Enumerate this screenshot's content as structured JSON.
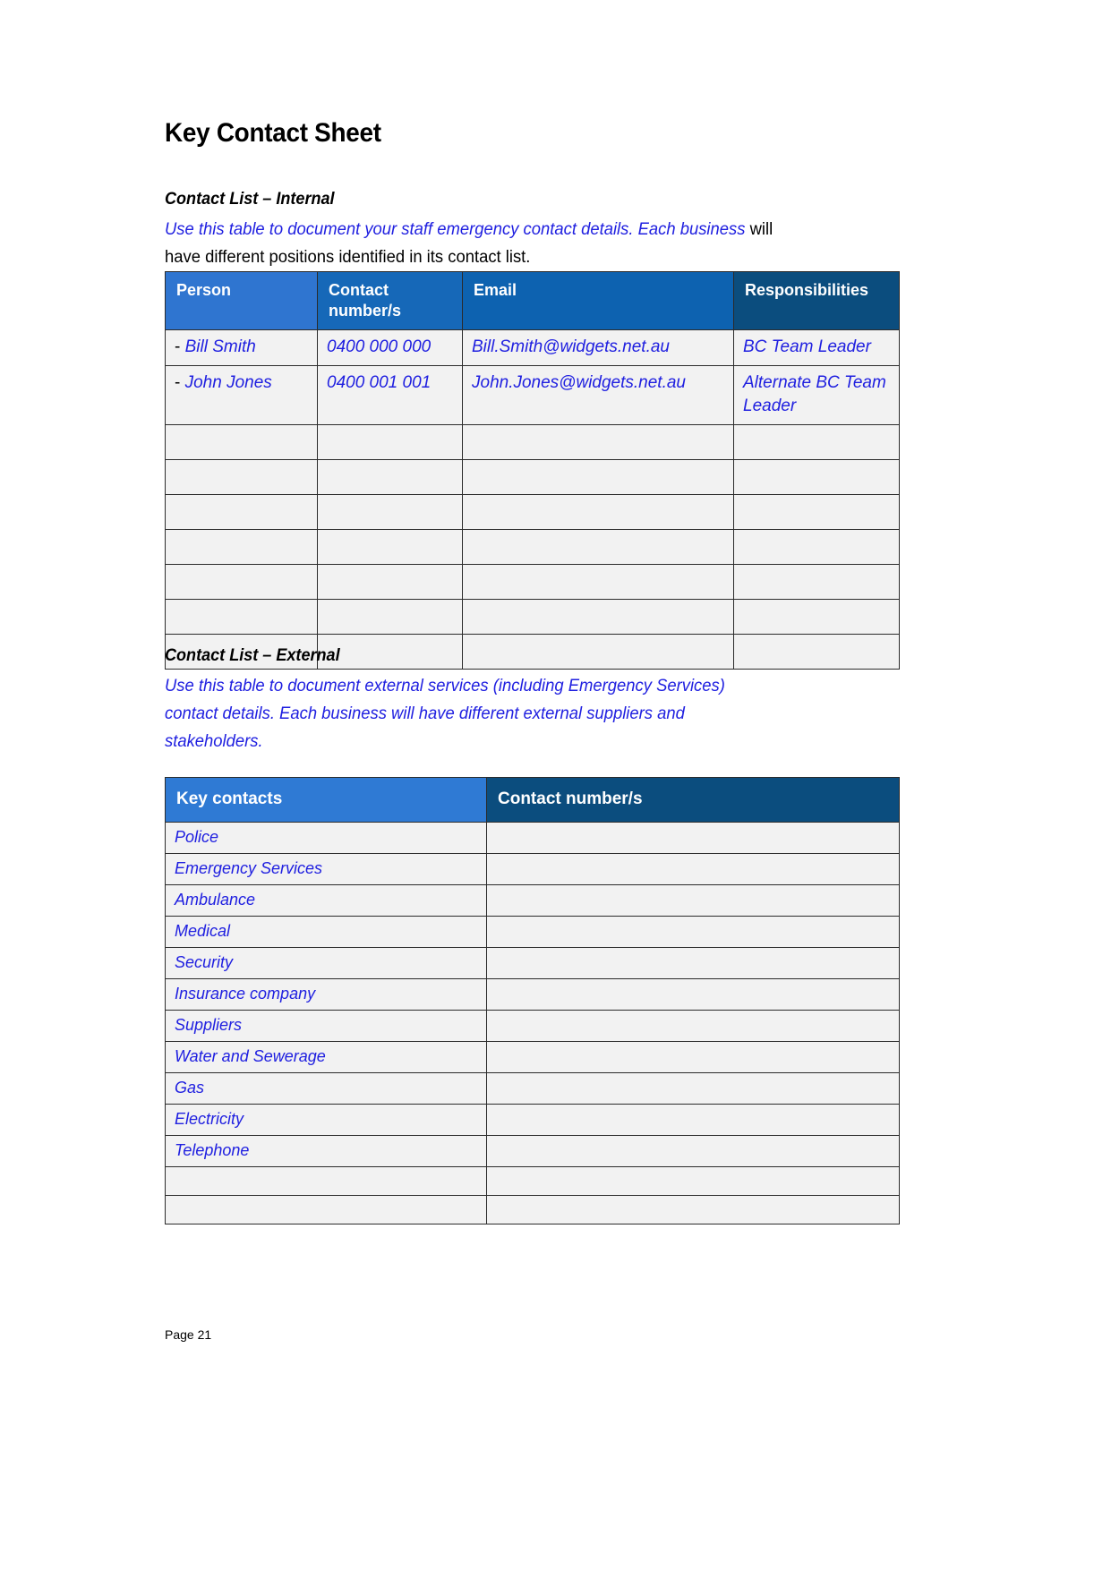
{
  "document": {
    "title": "Key Contact Sheet",
    "footer_page_label": "Page 21"
  },
  "colors": {
    "link_blue": "#2020e0",
    "header_blue_light": "#2f75d0",
    "header_blue_dark": "#0b4d7e",
    "cell_fill": "#f2f2f2",
    "border": "#2b2b2b"
  },
  "internal": {
    "heading": "Contact List – Internal",
    "intro_part1": "Use this table to document your staff emergency contact details. Each business",
    "intro_part2": " will have different positions identified in its contact list.",
    "columns": [
      "Person",
      "Contact number/s",
      "Email",
      "Responsibilities"
    ],
    "rows": [
      {
        "dash": "- ",
        "person": "Bill Smith",
        "contact": "0400 000 000",
        "email": "Bill.Smith@widgets.net.au",
        "responsibilities": "BC Team Leader"
      },
      {
        "dash": "- ",
        "person": "John Jones",
        "contact": "0400 001 001",
        "email": "John.Jones@widgets.net.au",
        "responsibilities": "Alternate BC Team Leader"
      }
    ],
    "empty_row_count": 7
  },
  "external": {
    "heading": "Contact List – External",
    "intro": "Use this table to document external services (including Emergency Services) contact details. Each business will have different external suppliers and stakeholders.",
    "columns": [
      "Key contacts",
      "Contact number/s"
    ],
    "rows": [
      {
        "label": "Police",
        "number": ""
      },
      {
        "label": "Emergency Services",
        "number": ""
      },
      {
        "label": "Ambulance",
        "number": ""
      },
      {
        "label": "Medical",
        "number": ""
      },
      {
        "label": "Security",
        "number": ""
      },
      {
        "label": "Insurance company",
        "number": ""
      },
      {
        "label": "Suppliers",
        "number": ""
      },
      {
        "label": "Water and Sewerage",
        "number": ""
      },
      {
        "label": "Gas",
        "number": ""
      },
      {
        "label": "Electricity",
        "number": ""
      },
      {
        "label": "Telephone",
        "number": ""
      }
    ],
    "empty_row_count": 2
  }
}
